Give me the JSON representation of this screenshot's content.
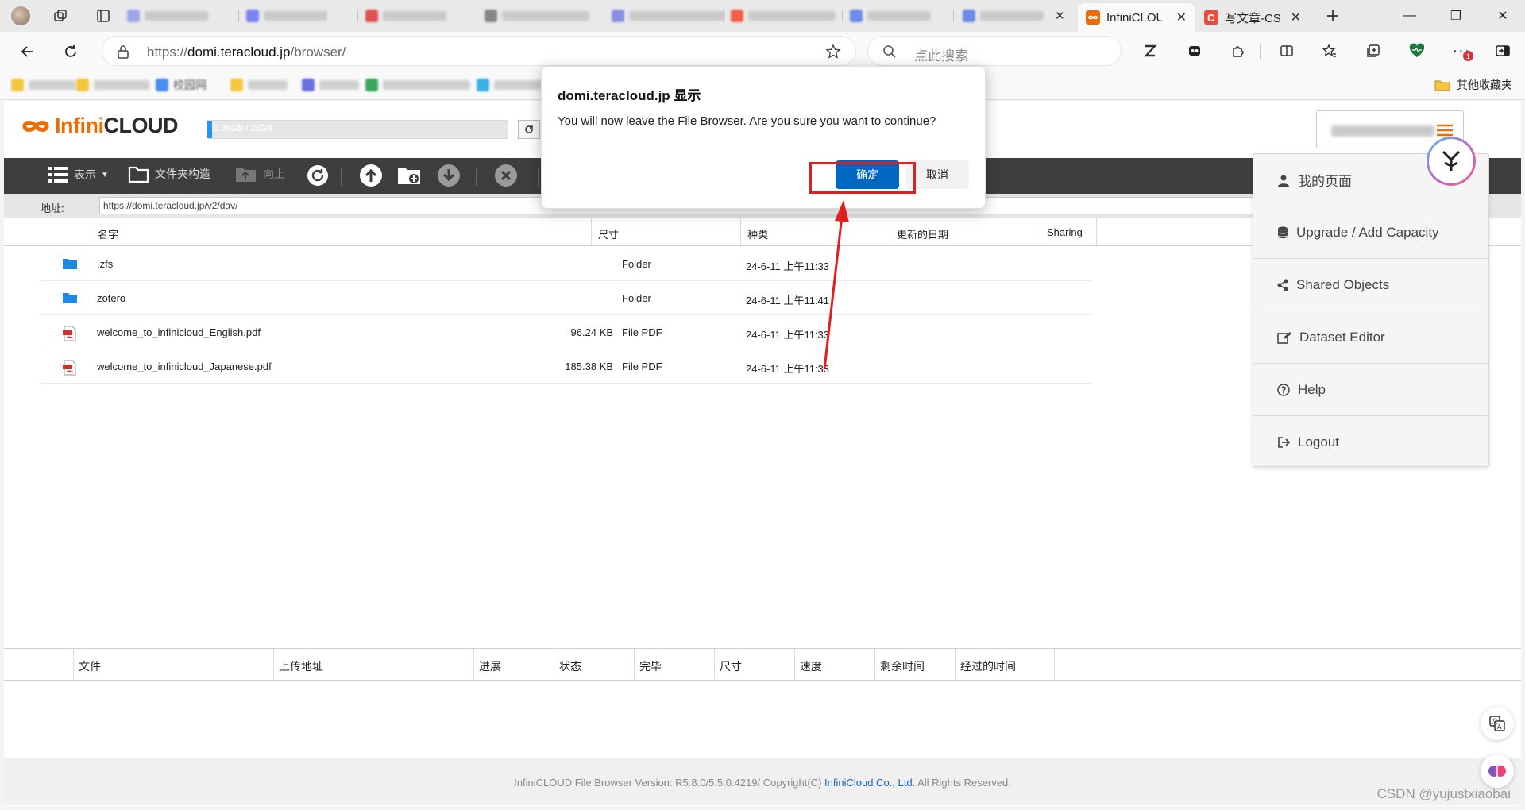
{
  "browser": {
    "tabs": [
      {
        "title": "InfiniCLOUD",
        "active": true
      },
      {
        "title": "写文章-CSDN",
        "active": false
      }
    ],
    "url_prefix": "https://",
    "url_host": "domi.teracloud.jp",
    "url_path": "/browser/",
    "search_placeholder": "点此搜索",
    "bookmarks_other": "其他收藏夹",
    "bookmark_blurred_label": "校园网"
  },
  "app": {
    "logo_text_infi": "Infini",
    "logo_text_rest": "CLOUD",
    "quota_label": "0.35GB / 25GB",
    "quota_fraction": 0.015,
    "toolbar": {
      "view": "表示",
      "folder_tree": "文件夹构造",
      "up": "向上"
    },
    "address_label": "地址:",
    "address_value": "https://domi.teracloud.jp/v2/dav/",
    "columns": [
      "名字",
      "尺寸",
      "种类",
      "更新的日期",
      "Sharing"
    ],
    "files": [
      {
        "name": ".zfs",
        "size": "",
        "type": "Folder",
        "date": "24-6-11  上午11:33",
        "icon": "folder-icon"
      },
      {
        "name": "zotero",
        "size": "",
        "type": "Folder",
        "date": "24-6-11  上午11:41",
        "icon": "folder-icon"
      },
      {
        "name": "welcome_to_infinicloud_English.pdf",
        "size": "96.24 KB",
        "type": "File PDF",
        "date": "24-6-11  上午11:33",
        "icon": "pdf-icon"
      },
      {
        "name": "welcome_to_infinicloud_Japanese.pdf",
        "size": "185.38 KB",
        "type": "File PDF",
        "date": "24-6-11  上午11:33",
        "icon": "pdf-icon"
      }
    ],
    "upload_columns": [
      "文件",
      "上传地址",
      "进展",
      "状态",
      "完毕",
      "尺寸",
      "速度",
      "剩余时间",
      "经过的时间"
    ],
    "footer_prefix": "InfiniCLOUD File Browser Version: R5.8.0/5.5.0.4219/ Copyright(C) ",
    "footer_link": "InfiniCloud Co., Ltd.",
    "footer_suffix": " All Rights Reserved."
  },
  "menu": {
    "items": [
      {
        "label": "我的页面",
        "icon": "user-icon"
      },
      {
        "label": "Upgrade / Add Capacity",
        "icon": "database-icon"
      },
      {
        "label": "Shared Objects",
        "icon": "share-icon"
      },
      {
        "label": "Dataset Editor",
        "icon": "edit-icon"
      },
      {
        "label": "Help",
        "icon": "help-icon"
      },
      {
        "label": "Logout",
        "icon": "logout-icon"
      }
    ]
  },
  "dialog": {
    "title": "domi.teracloud.jp 显示",
    "message": "You will now leave the File Browser. Are you sure you want to continue?",
    "ok_label": "确定",
    "cancel_label": "取消"
  },
  "watermark": "CSDN @yujustxiaobai",
  "colors": {
    "brand_orange": "#ef6c00",
    "primary_blue": "#0067c0",
    "toolbar_bg": "#3e3e3e",
    "highlight_red": "#e02020"
  }
}
